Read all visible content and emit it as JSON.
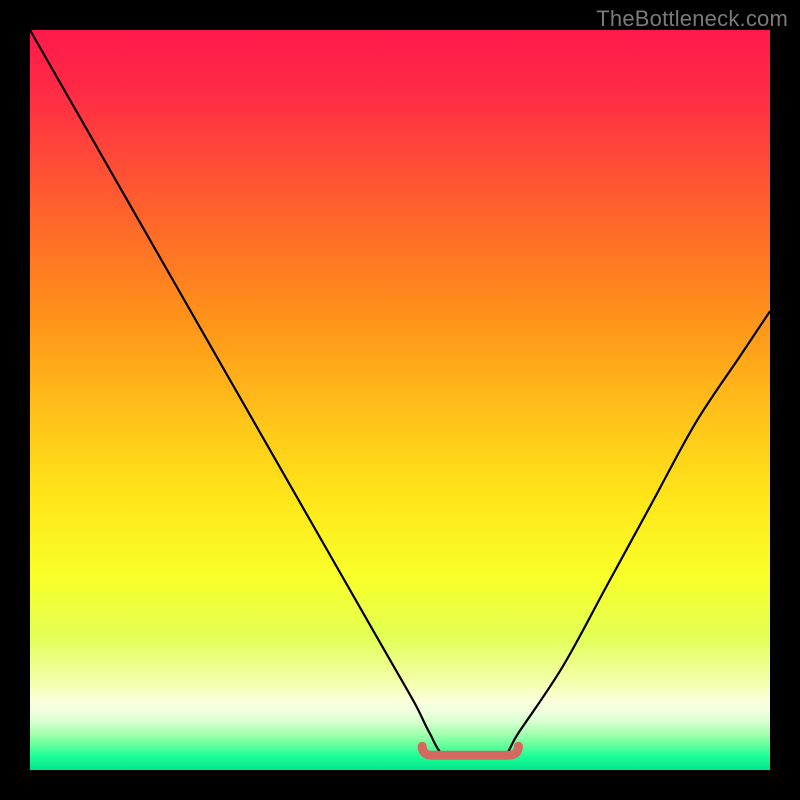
{
  "watermark": "TheBottleneck.com",
  "colors": {
    "black": "#000000",
    "curve": "#000000",
    "flat_segment": "#d46a5f",
    "gradient_stops": [
      {
        "offset": 0.0,
        "color": "#ff1a4b"
      },
      {
        "offset": 0.08,
        "color": "#ff2a46"
      },
      {
        "offset": 0.22,
        "color": "#ff5a30"
      },
      {
        "offset": 0.38,
        "color": "#ff8f1a"
      },
      {
        "offset": 0.52,
        "color": "#ffc21a"
      },
      {
        "offset": 0.64,
        "color": "#ffe81a"
      },
      {
        "offset": 0.74,
        "color": "#f8ff2a"
      },
      {
        "offset": 0.82,
        "color": "#e3ff55"
      },
      {
        "offset": 0.884,
        "color": "#f4ffb0"
      },
      {
        "offset": 0.905,
        "color": "#fbffd9"
      },
      {
        "offset": 0.92,
        "color": "#f0ffe0"
      },
      {
        "offset": 0.935,
        "color": "#d6ffcf"
      },
      {
        "offset": 0.95,
        "color": "#a8ffb0"
      },
      {
        "offset": 0.965,
        "color": "#6aff9c"
      },
      {
        "offset": 0.98,
        "color": "#22ff99"
      },
      {
        "offset": 1.0,
        "color": "#00e68a"
      }
    ]
  },
  "chart_data": {
    "type": "line",
    "title": "",
    "xlabel": "",
    "ylabel": "",
    "xlim": [
      0,
      100
    ],
    "ylim": [
      0,
      100
    ],
    "series": [
      {
        "name": "bottleneck-curve",
        "x": [
          0,
          4,
          8,
          12,
          16,
          20,
          24,
          28,
          32,
          36,
          40,
          44,
          48,
          52,
          54,
          56,
          60,
          64,
          66,
          72,
          78,
          84,
          90,
          96,
          100
        ],
        "y": [
          100,
          93,
          86,
          79,
          72,
          65,
          58,
          51,
          44,
          37,
          30,
          23,
          16,
          9,
          5,
          2,
          2,
          2,
          5,
          14,
          25,
          36,
          47,
          56,
          62
        ]
      }
    ],
    "annotations": [
      {
        "name": "flat-minimum-segment",
        "x_start": 53,
        "x_end": 66,
        "y": 2
      }
    ],
    "background": "vertical-gradient"
  }
}
